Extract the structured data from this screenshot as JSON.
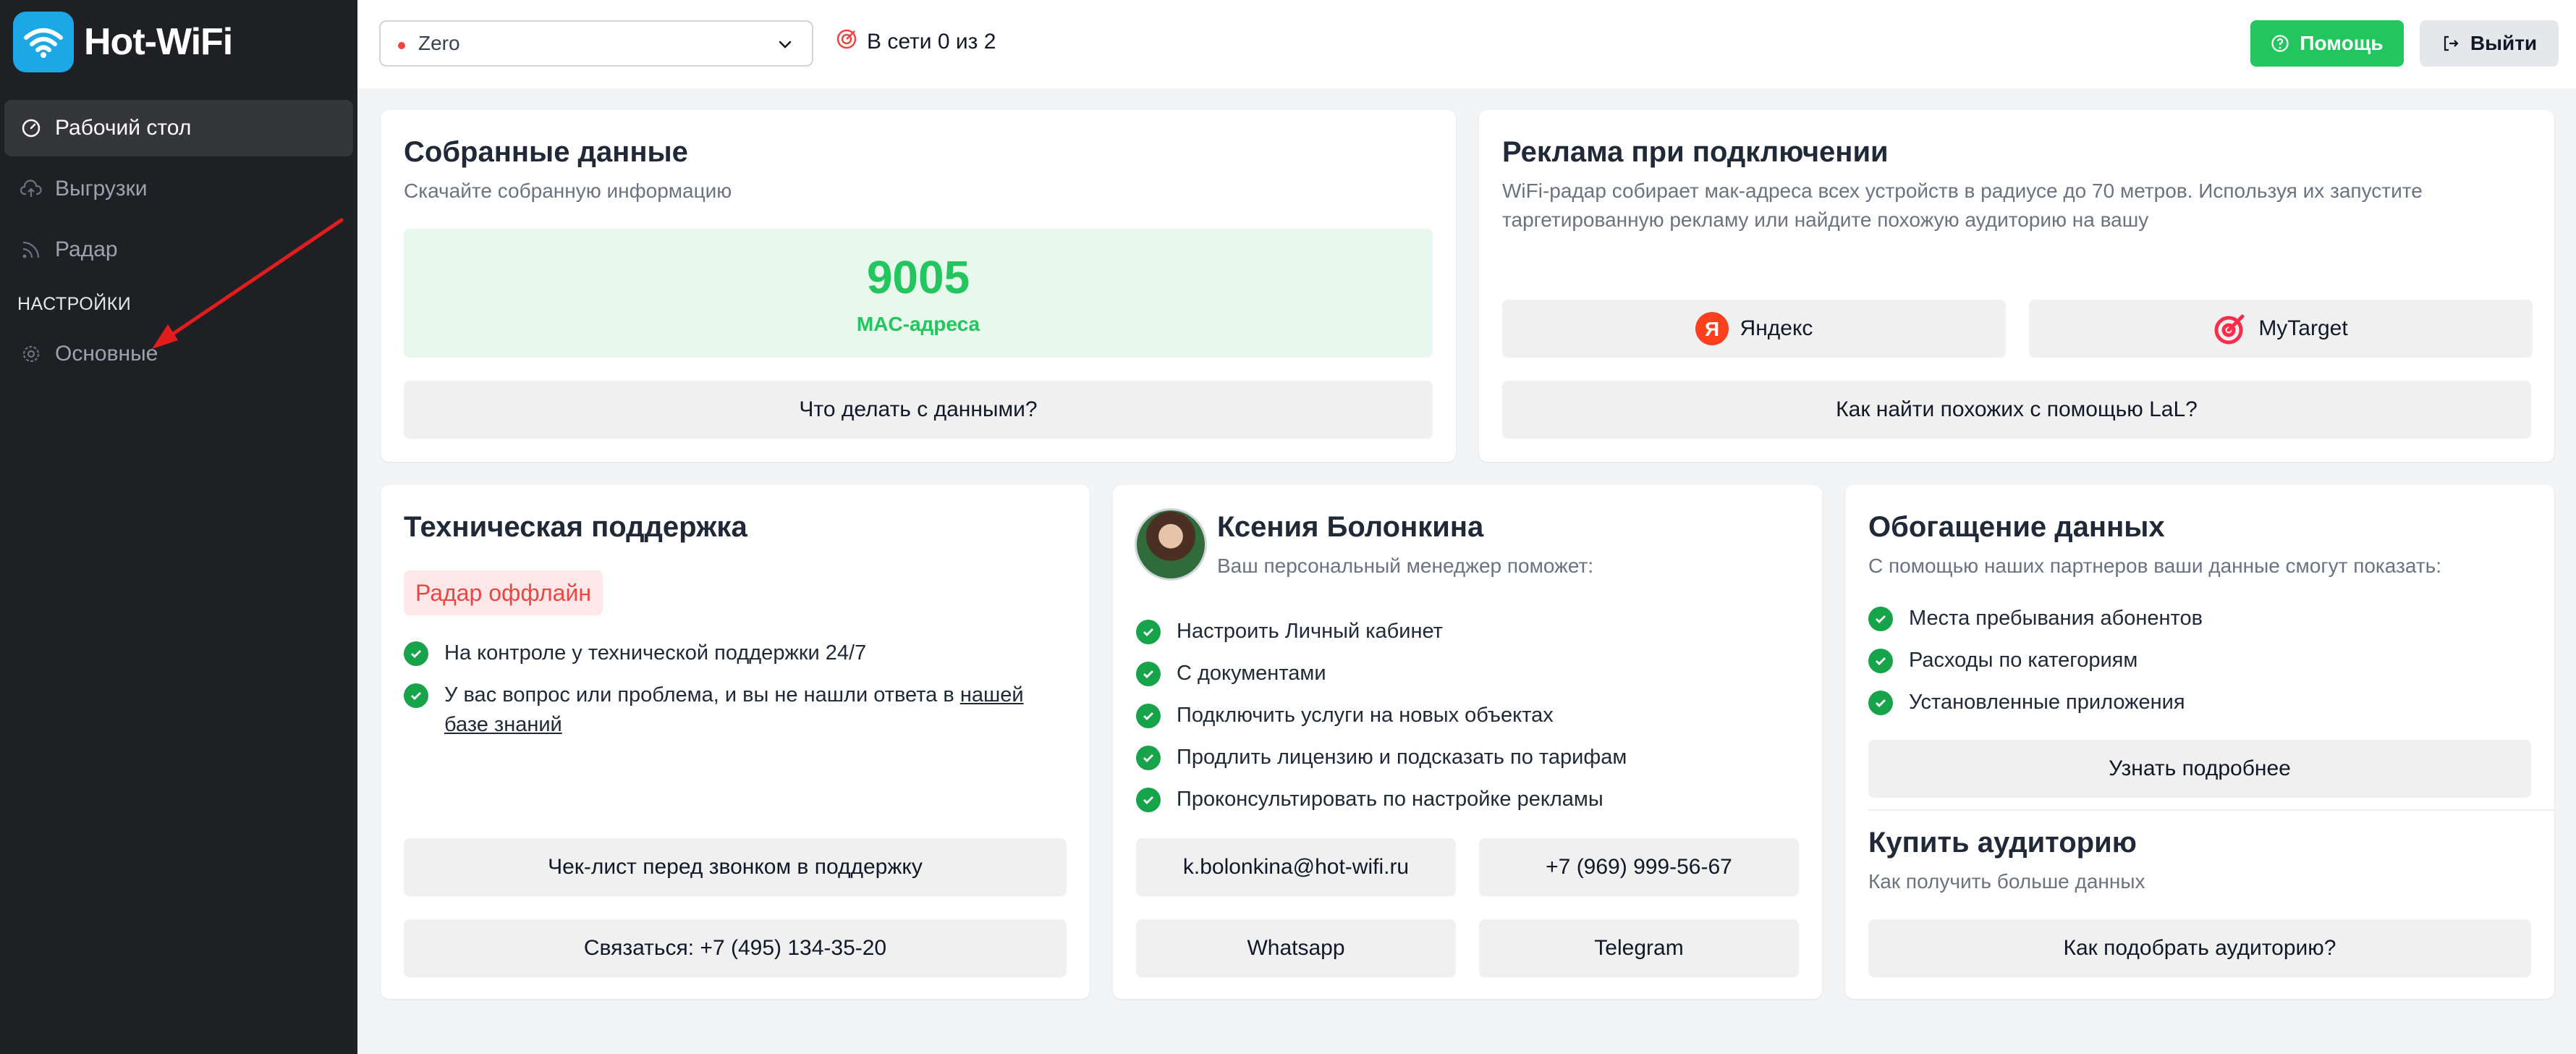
{
  "app": {
    "name": "Hot-WiFi"
  },
  "sidebar": {
    "items": [
      {
        "label": "Рабочий стол",
        "icon": "dashboard-gauge-icon",
        "active": true
      },
      {
        "label": "Выгрузки",
        "icon": "cloud-upload-icon",
        "active": false
      },
      {
        "label": "Радар",
        "icon": "rss-radar-icon",
        "active": false
      }
    ],
    "section_label": "НАСТРОЙКИ",
    "settings_items": [
      {
        "label": "Основные",
        "icon": "gear-icon",
        "active": false
      }
    ]
  },
  "topbar": {
    "location_select": {
      "value": "Zero",
      "status_color": "#ef4444"
    },
    "online_status": "В сети 0 из 2",
    "help_label": "Помощь",
    "logout_label": "Выйти"
  },
  "collected": {
    "title": "Собранные данные",
    "subtitle": "Скачайте собранную информацию",
    "count": "9005",
    "count_label": "MAC-адреса",
    "button": "Что делать с данными?"
  },
  "ads": {
    "title": "Реклама при подключении",
    "description": "WiFi-радар собирает мак-адреса всех устройств в радиусе до 70 метров. Используя их запустите таргетированную рекламу или найдите похожую аудиторию на вашу",
    "yandex_label": "Яндекс",
    "mytarget_label": "MyTarget",
    "lal_button": "Как найти похожих с помощью LaL?"
  },
  "support": {
    "title": "Техническая поддержка",
    "status_badge": "Радар оффлайн",
    "items": [
      "На контроле у технической поддержки 24/7"
    ],
    "question_text": "У вас вопрос или проблема, и вы не нашли ответа в ",
    "kb_link": "нашей базе знаний",
    "checklist_button": "Чек-лист перед звонком в поддержку",
    "contact_button": "Связаться: +7 (495) 134-35-20"
  },
  "manager": {
    "name": "Ксения Болонкина",
    "subtitle": "Ваш персональный менеджер поможет:",
    "items": [
      "Настроить Личный кабинет",
      "С документами",
      "Подключить услуги на новых объектах",
      "Продлить лицензию и подсказать по тарифам",
      "Проконсультировать по настройке рекламы"
    ],
    "email": "k.bolonkina@hot-wifi.ru",
    "phone": "+7 (969) 999-56-67",
    "whatsapp": "Whatsapp",
    "telegram": "Telegram"
  },
  "enrichment": {
    "title": "Обогащение данных",
    "subtitle": "С помощью наших партнеров ваши данные смогут показать:",
    "items": [
      "Места пребывания абонентов",
      "Расходы по категориям",
      "Установленные приложения"
    ],
    "more_button": "Узнать подробнее"
  },
  "audience": {
    "title": "Купить аудиторию",
    "subtitle": "Как получить больше данных",
    "button": "Как подобрать аудиторию?"
  },
  "colors": {
    "accent_green": "#22c55e",
    "check_green": "#16a34a",
    "sidebar_bg": "#1f2023",
    "logo_blue": "#1ca7e6",
    "offline_red": "#ef4444",
    "annotation_arrow": "#e11d1d"
  }
}
